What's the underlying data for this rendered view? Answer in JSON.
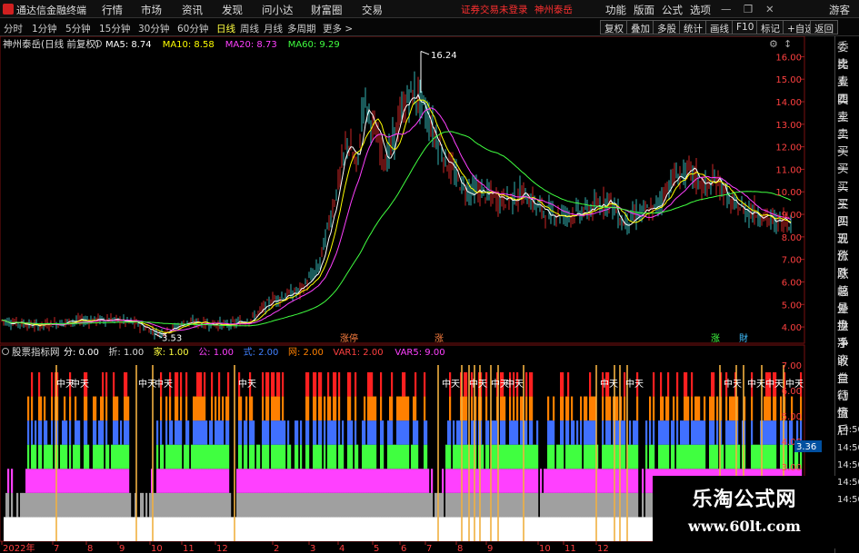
{
  "menubar": {
    "app_title": "通达信金融终端",
    "menus": [
      "行情",
      "市场",
      "资讯",
      "发现",
      "问小达",
      "财富圈",
      "交易"
    ],
    "notice": "证券交易未登录",
    "stock_name": "神州泰岳",
    "right_menus": [
      "功能",
      "版面",
      "公式",
      "选项"
    ],
    "guest": "游客"
  },
  "toolbar": {
    "periods": [
      "分时",
      "1分钟",
      "5分钟",
      "15分钟",
      "30分钟",
      "60分钟",
      "日线",
      "周线",
      "月线",
      "多周期",
      "更多 >"
    ],
    "active_period": "日线",
    "right_buttons": [
      "复权",
      "叠加",
      "多股",
      "统计",
      "画线",
      "F10",
      "标记",
      "+自选",
      "返回"
    ]
  },
  "main_chart": {
    "title": "神州泰岳(日线 前复权)",
    "ma_labels": [
      {
        "text": "MA5: 8.74",
        "color": "#ffffff"
      },
      {
        "text": "MA10: 8.58",
        "color": "#ffff00"
      },
      {
        "text": "MA20: 8.73",
        "color": "#ff40ff"
      },
      {
        "text": "MA60: 9.29",
        "color": "#40ff40"
      }
    ],
    "y_ticks": [
      "16.00",
      "15.00",
      "14.00",
      "13.00",
      "12.00",
      "11.00",
      "10.00",
      "9.00",
      "8.00",
      "7.00",
      "6.00",
      "5.00",
      "4.00"
    ],
    "y_range": [
      3.6,
      16.5
    ],
    "high_label": "16.24",
    "low_label": "3.53",
    "event_markers": [
      "涨停",
      "涨",
      "涨",
      "財"
    ]
  },
  "indicator": {
    "name": "股票指标网",
    "labels": [
      {
        "text": "分: 0.00",
        "color": "#ffffff"
      },
      {
        "text": "折: 1.00",
        "color": "#dddddd"
      },
      {
        "text": "家: 1.00",
        "color": "#ffff40"
      },
      {
        "text": "公: 1.00",
        "color": "#ff40ff"
      },
      {
        "text": "式: 2.00",
        "color": "#4080ff"
      },
      {
        "text": "网: 2.00",
        "color": "#ff8000"
      },
      {
        "text": "VAR1: 2.00",
        "color": "#ff4040"
      },
      {
        "text": "VAR5: 9.00",
        "color": "#ff40ff"
      }
    ],
    "y_ticks": [
      "7.00",
      "6.00",
      "5.00",
      "4.00",
      "3.00"
    ],
    "highlight_value": "3.36",
    "marker_text": "中天"
  },
  "x_axis": {
    "labels": [
      "2022年",
      "7",
      "8",
      "9",
      "10",
      "11",
      "12",
      "2",
      "3",
      "4",
      "5",
      "6",
      "7",
      "8",
      "9",
      "10",
      "11",
      "12"
    ]
  },
  "right_panel": {
    "items": [
      "委比",
      "卖五",
      "卖四",
      "卖三",
      "卖二",
      "卖一",
      "买一",
      "买二",
      "买三",
      "买四",
      "买五",
      "现价",
      "涨跌",
      "涨幅",
      "总量",
      "外盘",
      "换手",
      "净资",
      "收益",
      "自动",
      "行情",
      "盘后",
      "14:50",
      "14:50",
      "14:50",
      "14:50",
      "14:50"
    ]
  },
  "watermark": {
    "line1": "乐淘公式网",
    "line2": "www.60lt.com"
  }
}
